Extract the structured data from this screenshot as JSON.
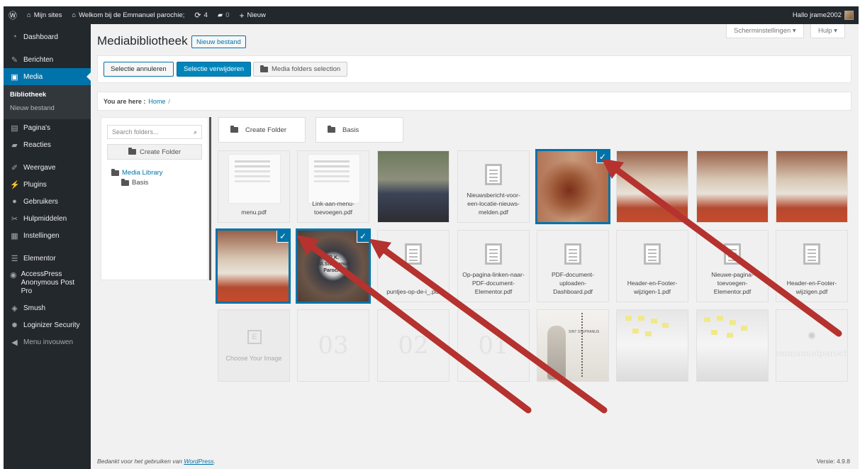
{
  "adminbar": {
    "my_sites": "Mijn sites",
    "site_name": "Welkom bij de Emmanuel parochie;",
    "updates_count": "4",
    "comments_count": "0",
    "new_label": "Nieuw",
    "greeting": "Hallo jrame2002"
  },
  "sidebar": {
    "dashboard": "Dashboard",
    "posts": "Berichten",
    "media": "Media",
    "media_sub": [
      "Bibliotheek",
      "Nieuw bestand"
    ],
    "pages": "Pagina's",
    "comments": "Reacties",
    "appearance": "Weergave",
    "plugins": "Plugins",
    "users": "Gebruikers",
    "tools": "Hulpmiddelen",
    "settings": "Instellingen",
    "elementor": "Elementor",
    "accesspress": "AccessPress Anonymous Post Pro",
    "smush": "Smush",
    "loginizer": "Loginizer Security",
    "collapse": "Menu invouwen"
  },
  "header": {
    "screen_options": "Scherminstellingen ▾",
    "help": "Hulp ▾",
    "title": "Mediabibliotheek",
    "add_new": "Nieuw bestand"
  },
  "toolbar": {
    "cancel_selection": "Selectie annuleren",
    "delete_selection": "Selectie verwijderen",
    "folders_selection": "Media folders selection"
  },
  "breadcrumb": {
    "label": "You are here :",
    "home": "Home",
    "sep": "/"
  },
  "folders": {
    "search_placeholder": "Search folders...",
    "create_folder": "Create Folder",
    "root": "Media Library",
    "child": "Basis"
  },
  "folder_tiles": {
    "create": "Create Folder",
    "basis": "Basis"
  },
  "grid": {
    "row1": [
      "menu.pdf",
      "Link-aan-menu-toevoegen.pdf",
      "",
      "Nieuwsbericht-voor-een-locatie-nieuws-melden.pdf",
      "",
      "",
      "",
      ""
    ],
    "row2": [
      "",
      "",
      "puntjes-op-de-i_.pdf",
      "Op-pagina-linken-naar-PDF-document-Elementor.pdf",
      "PDF-document-uploaden-Dashboard.pdf",
      "Header-en-Footer-wijzigen-1.pdf",
      "Nieuwe-pagina-toevoegen-Elementor.pdf",
      "Header-en-Footer-wijzigen.pdf"
    ],
    "row3_choose": "Choose Your Image",
    "row3_numbers": [
      "03",
      "02",
      "01"
    ],
    "row3_watermark": "emmanuelparoch",
    "sign_text": [
      "R.K.",
      "St.Stephanus",
      "Parochie"
    ],
    "statue_text": "SINT STEPHANUS"
  },
  "footer": {
    "thanks": "Bedankt voor het gebruiken van",
    "wordpress": "WordPress",
    "version": "Versie: 4.9.8"
  },
  "colors": {
    "accent": "#0073aa",
    "adminbar": "#23282d",
    "arrow": "#b5322e"
  }
}
